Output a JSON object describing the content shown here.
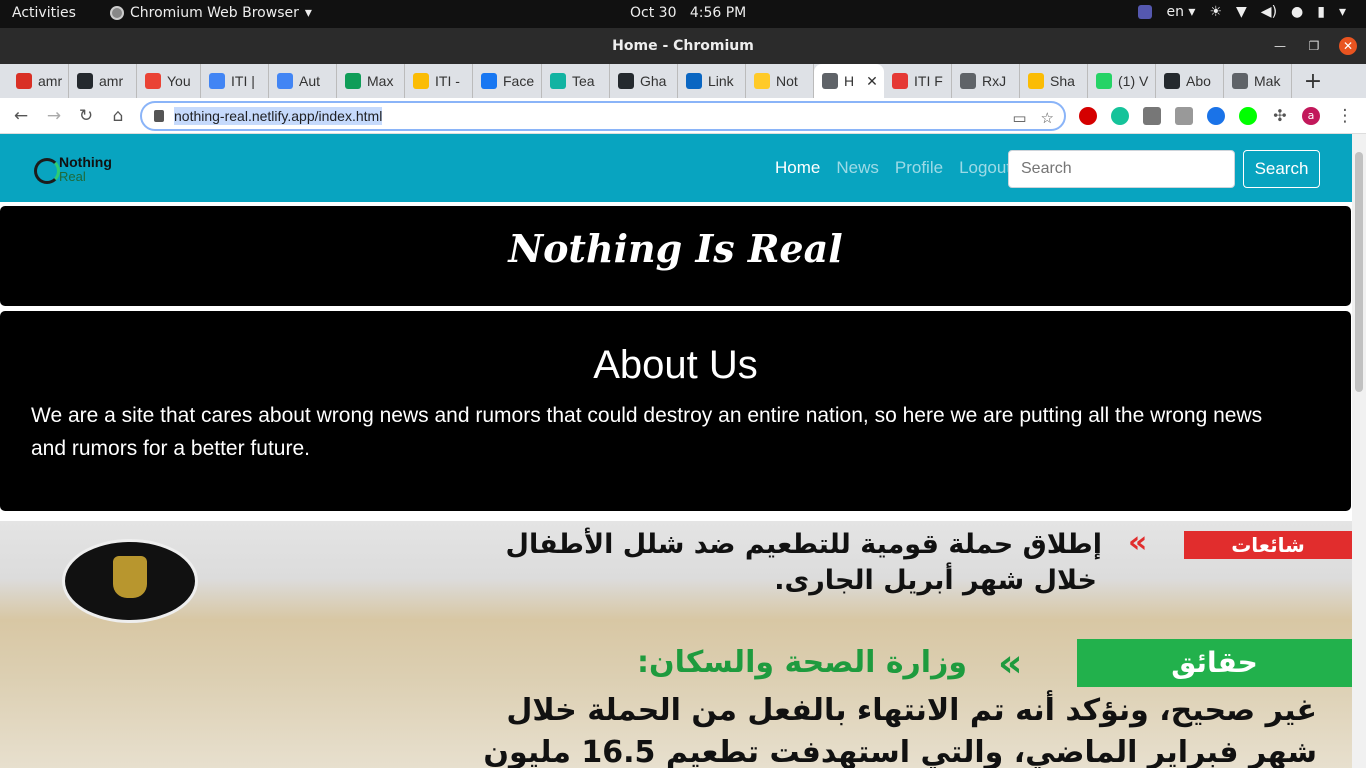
{
  "system": {
    "activities": "Activities",
    "app_name": "Chromium Web Browser",
    "date": "Oct 30",
    "time": "4:56 PM",
    "lang": "en"
  },
  "window": {
    "title": "Home - Chromium"
  },
  "tabs": [
    {
      "label": "amr",
      "color": "#d93025"
    },
    {
      "label": "amr",
      "color": "#24292e"
    },
    {
      "label": "You",
      "color": "#ea4335"
    },
    {
      "label": "ITI |",
      "color": "#4285f4"
    },
    {
      "label": "Aut",
      "color": "#4285f4"
    },
    {
      "label": "Max",
      "color": "#0f9d58"
    },
    {
      "label": "ITI -",
      "color": "#fbbc04"
    },
    {
      "label": "Face",
      "color": "#1877f2"
    },
    {
      "label": "Tea",
      "color": "#12b3a2"
    },
    {
      "label": "Gha",
      "color": "#24292e"
    },
    {
      "label": "Link",
      "color": "#0a66c2"
    },
    {
      "label": "Not",
      "color": "#ffca28"
    },
    {
      "label": "H",
      "color": "#5f6368",
      "active": true
    },
    {
      "label": "ITI F",
      "color": "#e53935"
    },
    {
      "label": "RxJ",
      "color": "#5f6368"
    },
    {
      "label": "Sha",
      "color": "#fbbc04"
    },
    {
      "label": "(1) V",
      "color": "#25d366"
    },
    {
      "label": "Abo",
      "color": "#24292e"
    },
    {
      "label": "Mak",
      "color": "#5f6368"
    }
  ],
  "address_bar": {
    "url": "nothing-real.netlify.app/index.html"
  },
  "site": {
    "brand_line1": "Nothing",
    "brand_line2": "Real",
    "nav": {
      "home": "Home",
      "news": "News",
      "profile": "Profile",
      "logout": "Logout"
    },
    "search_placeholder": "Search",
    "search_button": "Search",
    "hero_title": "Nothing Is Real",
    "about_title": "About Us",
    "about_text": "We are a site that cares about wrong news and rumors that could destroy an entire nation, so here we are putting all the wrong news and rumors for a better future."
  },
  "banner": {
    "rumor_tag": "شائعات",
    "rumor_line1": "إطلاق حملة قومية للتطعيم ضد شلل الأطفال",
    "rumor_line2": "خلال شهر أبريل الجارى.",
    "facts_tag": "حقائق",
    "ministry": "وزارة الصحة والسكان:",
    "fact_line1": "غير صحيح، ونؤكد أنه تم الانتهاء بالفعل من الحملة خلال",
    "fact_line2": "شهر فبراير الماضي، والتي استهدفت تطعيم 16.5 مليون"
  },
  "colors": {
    "navbar": "#08a4c0",
    "card": "#000000",
    "rumor_red": "#e12d2d",
    "fact_green": "#22b14c"
  }
}
